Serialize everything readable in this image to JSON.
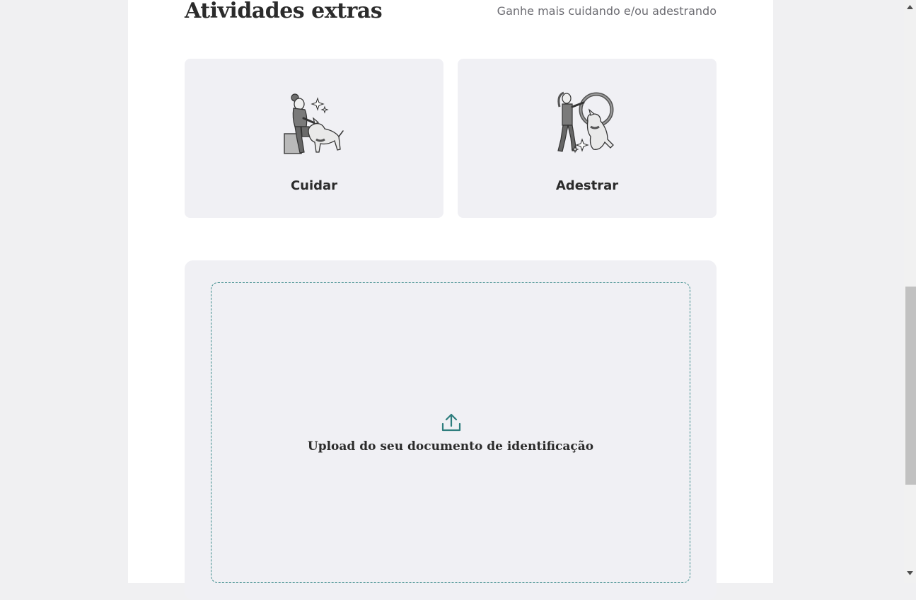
{
  "section": {
    "title": "Atividades extras",
    "subtitle": "Ganhe mais cuidando e/ou adestrando"
  },
  "activities": [
    {
      "label": "Cuidar",
      "icon": "pet-sitting-illustration-icon"
    },
    {
      "label": "Adestrar",
      "icon": "dog-training-illustration-icon"
    }
  ],
  "upload": {
    "label": "Upload do seu documento de identificação",
    "icon": "upload-icon",
    "accent_color": "#2e7d7d"
  }
}
